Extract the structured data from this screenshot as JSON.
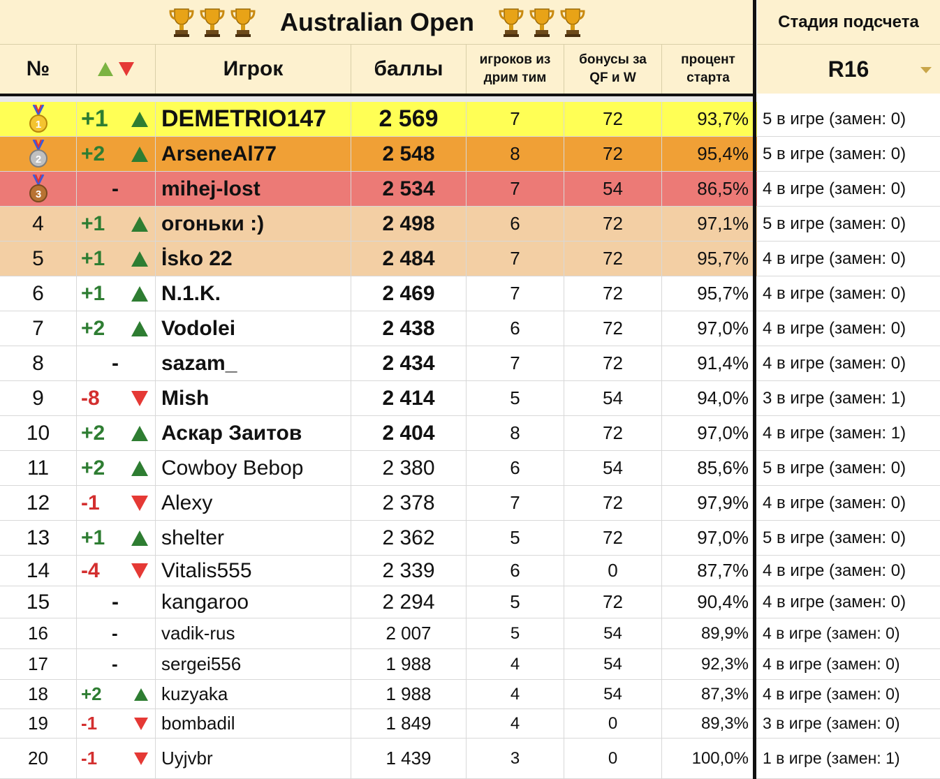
{
  "header": {
    "title": "Australian Open",
    "stage_label": "Стадия подсчета",
    "stage_value": "R16",
    "columns": {
      "num": "№",
      "player": "Игрок",
      "points": "баллы",
      "dream_team": "игроков из дрим тим",
      "bonus": "бонусы за QF и W",
      "start_pct": "процент старта"
    }
  },
  "colors": {
    "gold_row": "#ffff55",
    "silver_row": "#f0a036",
    "bronze_row": "#ec7a76",
    "top5_row": "#f3cfa4",
    "header_bg": "#fdf1cf",
    "up": "#2e7d32",
    "down": "#e53935"
  },
  "rows": [
    {
      "rank": "1",
      "medal": "1",
      "change": "+1",
      "dir": "up",
      "player": "DEMETRIO147",
      "points": "2 569",
      "dream": "7",
      "bonus": "72",
      "pct": "93,7%",
      "status": "5 в игре (замен: 0)"
    },
    {
      "rank": "2",
      "medal": "2",
      "change": "+2",
      "dir": "up",
      "player": "ArseneAl77",
      "points": "2 548",
      "dream": "8",
      "bonus": "72",
      "pct": "95,4%",
      "status": "5 в игре (замен: 0)"
    },
    {
      "rank": "3",
      "medal": "3",
      "change": "-",
      "dir": "same",
      "player": "mihej-lost",
      "points": "2 534",
      "dream": "7",
      "bonus": "54",
      "pct": "86,5%",
      "status": "4 в игре (замен: 0)"
    },
    {
      "rank": "4",
      "change": "+1",
      "dir": "up",
      "player": "огоньки :)",
      "points": "2 498",
      "dream": "6",
      "bonus": "72",
      "pct": "97,1%",
      "status": "5 в игре (замен: 0)"
    },
    {
      "rank": "5",
      "change": "+1",
      "dir": "up",
      "player": "İsko 22",
      "points": "2 484",
      "dream": "7",
      "bonus": "72",
      "pct": "95,7%",
      "status": "4 в игре (замен: 0)"
    },
    {
      "rank": "6",
      "change": "+1",
      "dir": "up",
      "player": "N.1.K.",
      "points": "2 469",
      "dream": "7",
      "bonus": "72",
      "pct": "95,7%",
      "status": "4 в игре (замен: 0)"
    },
    {
      "rank": "7",
      "change": "+2",
      "dir": "up",
      "player": "Vodolei",
      "points": "2 438",
      "dream": "6",
      "bonus": "72",
      "pct": "97,0%",
      "status": "4 в игре (замен: 0)"
    },
    {
      "rank": "8",
      "change": "-",
      "dir": "same",
      "player": "sazam_",
      "points": "2 434",
      "dream": "7",
      "bonus": "72",
      "pct": "91,4%",
      "status": "4 в игре (замен: 0)"
    },
    {
      "rank": "9",
      "change": "-8",
      "dir": "down",
      "player": "Mish",
      "points": "2 414",
      "dream": "5",
      "bonus": "54",
      "pct": "94,0%",
      "status": "3 в игре (замен: 1)"
    },
    {
      "rank": "10",
      "change": "+2",
      "dir": "up",
      "player": "Аскар Заитов",
      "points": "2 404",
      "dream": "8",
      "bonus": "72",
      "pct": "97,0%",
      "status": "4 в игре (замен: 1)"
    },
    {
      "rank": "11",
      "change": "+2",
      "dir": "up",
      "player": "Cowboy Bebop",
      "points": "2 380",
      "dream": "6",
      "bonus": "54",
      "pct": "85,6%",
      "status": "5 в игре (замен: 0)"
    },
    {
      "rank": "12",
      "change": "-1",
      "dir": "down",
      "player": "Alexy",
      "points": "2 378",
      "dream": "7",
      "bonus": "72",
      "pct": "97,9%",
      "status": "4 в игре (замен: 0)"
    },
    {
      "rank": "13",
      "change": "+1",
      "dir": "up",
      "player": "shelter",
      "points": "2 362",
      "dream": "5",
      "bonus": "72",
      "pct": "97,0%",
      "status": "5 в игре (замен: 0)"
    },
    {
      "rank": "14",
      "change": "-4",
      "dir": "down",
      "player": "Vitalis555",
      "points": "2 339",
      "dream": "6",
      "bonus": "0",
      "pct": "87,7%",
      "status": "4 в игре (замен: 0)"
    },
    {
      "rank": "15",
      "change": "-",
      "dir": "same",
      "player": "kangaroo",
      "points": "2 294",
      "dream": "5",
      "bonus": "72",
      "pct": "90,4%",
      "status": "4 в игре (замен: 0)"
    },
    {
      "rank": "16",
      "change": "-",
      "dir": "same",
      "player": "vadik-rus",
      "points": "2 007",
      "dream": "5",
      "bonus": "54",
      "pct": "89,9%",
      "status": "4 в игре (замен: 0)"
    },
    {
      "rank": "17",
      "change": "-",
      "dir": "same",
      "player": "sergei556",
      "points": "1 988",
      "dream": "4",
      "bonus": "54",
      "pct": "92,3%",
      "status": "4 в игре (замен: 0)"
    },
    {
      "rank": "18",
      "change": "+2",
      "dir": "up",
      "player": "kuzyaka",
      "points": "1 988",
      "dream": "4",
      "bonus": "54",
      "pct": "87,3%",
      "status": "4 в игре (замен: 0)"
    },
    {
      "rank": "19",
      "change": "-1",
      "dir": "down",
      "player": "bombadil",
      "points": "1 849",
      "dream": "4",
      "bonus": "0",
      "pct": "89,3%",
      "status": "3 в игре (замен: 0)"
    },
    {
      "rank": "20",
      "change": "-1",
      "dir": "down",
      "player": "Uyjvbr",
      "points": "1 439",
      "dream": "3",
      "bonus": "0",
      "pct": "100,0%",
      "status": "1 в игре (замен: 1)"
    }
  ]
}
